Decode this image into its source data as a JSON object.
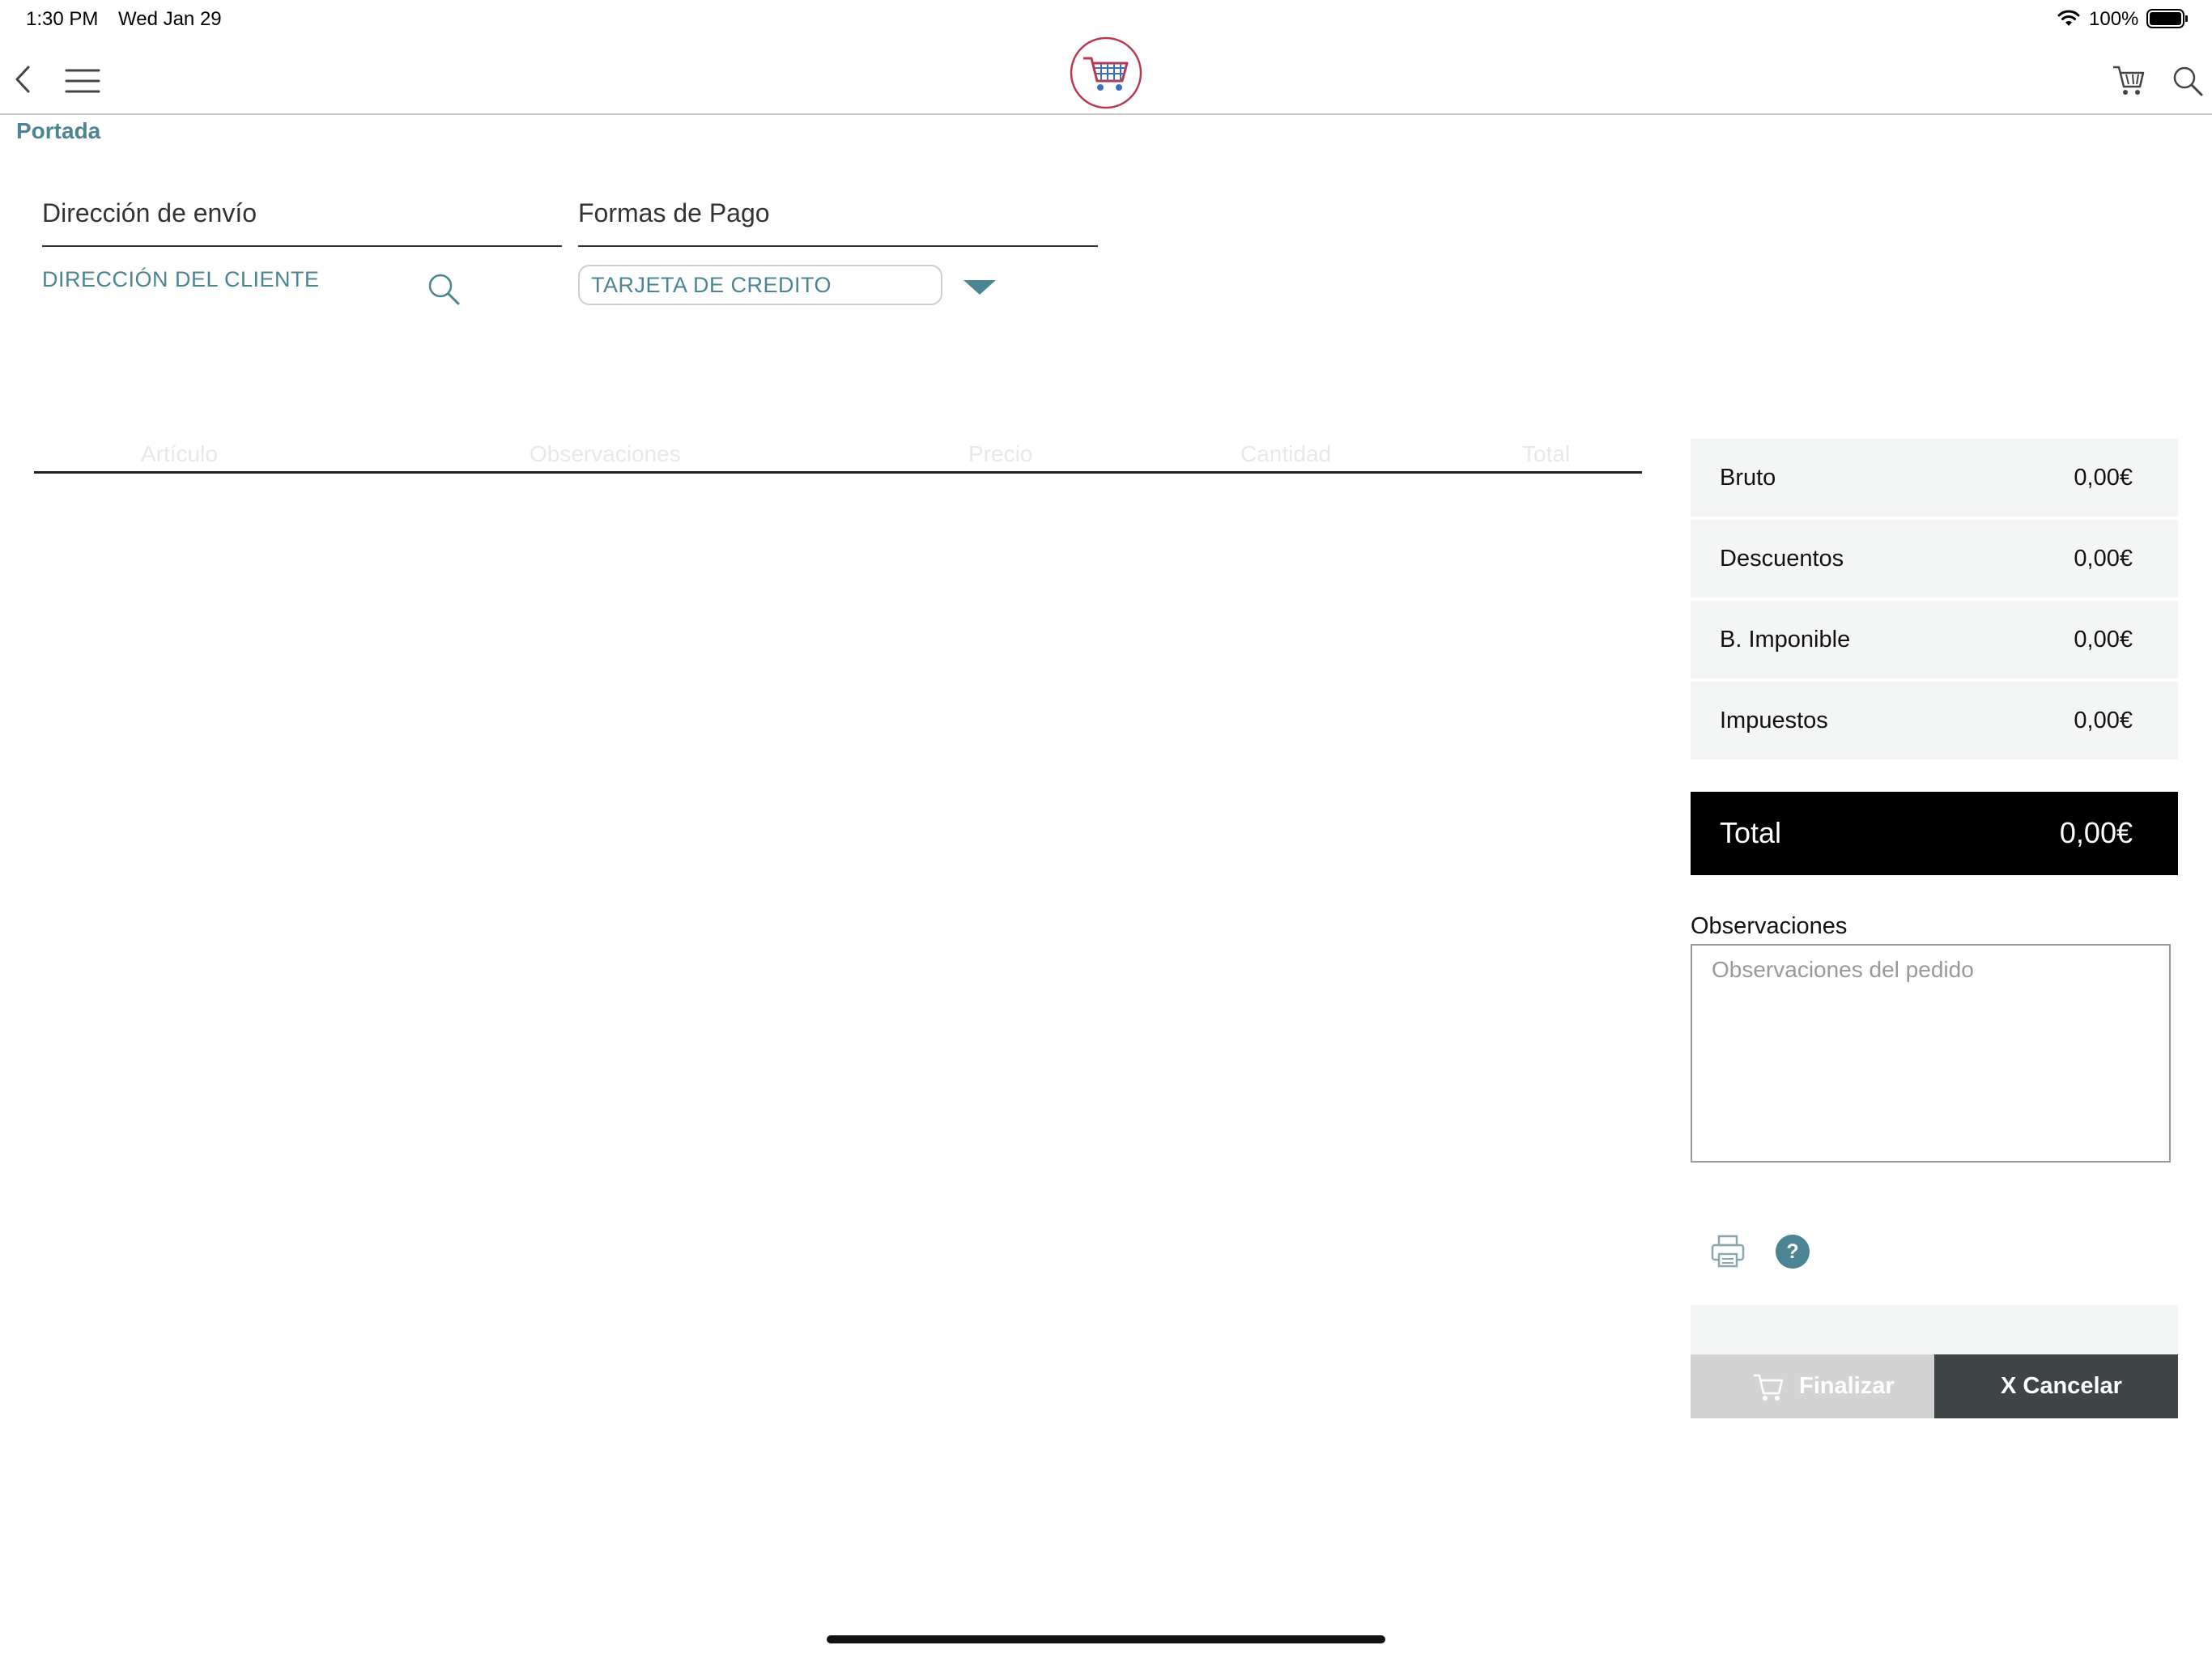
{
  "status_bar": {
    "time": "1:30 PM",
    "date": "Wed Jan 29",
    "battery": "100%"
  },
  "nav": {
    "breadcrumb": "Portada",
    "icons": [
      "back-chevron-icon",
      "hamburger-menu-icon",
      "cart-logo-icon",
      "cart-icon",
      "search-icon"
    ]
  },
  "shipping": {
    "title": "Dirección de envío",
    "value": "DIRECCIÓN DEL CLIENTE"
  },
  "payment": {
    "title": "Formas de Pago",
    "selected": "TARJETA DE CREDITO"
  },
  "table": {
    "columns": [
      "Artículo",
      "Observaciones",
      "Precio",
      "Cantidad",
      "Total"
    ],
    "rows": []
  },
  "summary": {
    "rows": [
      {
        "label": "Bruto",
        "value": "0,00€"
      },
      {
        "label": "Descuentos",
        "value": "0,00€"
      },
      {
        "label": "B. Imponible",
        "value": "0,00€"
      },
      {
        "label": "Impuestos",
        "value": "0,00€"
      }
    ],
    "total_label": "Total",
    "total_value": "0,00€"
  },
  "notes": {
    "label": "Observaciones",
    "placeholder": "Observaciones del pedido"
  },
  "actions": {
    "finalize_label": "Finalizar",
    "cancel_label": "X Cancelar"
  },
  "colors": {
    "accent": "#4b8593",
    "total_bg": "#000000",
    "cancel_bg": "#3f4446",
    "finalize_bg": "#d3d3d3",
    "panel_bg": "#f4f5f5"
  }
}
